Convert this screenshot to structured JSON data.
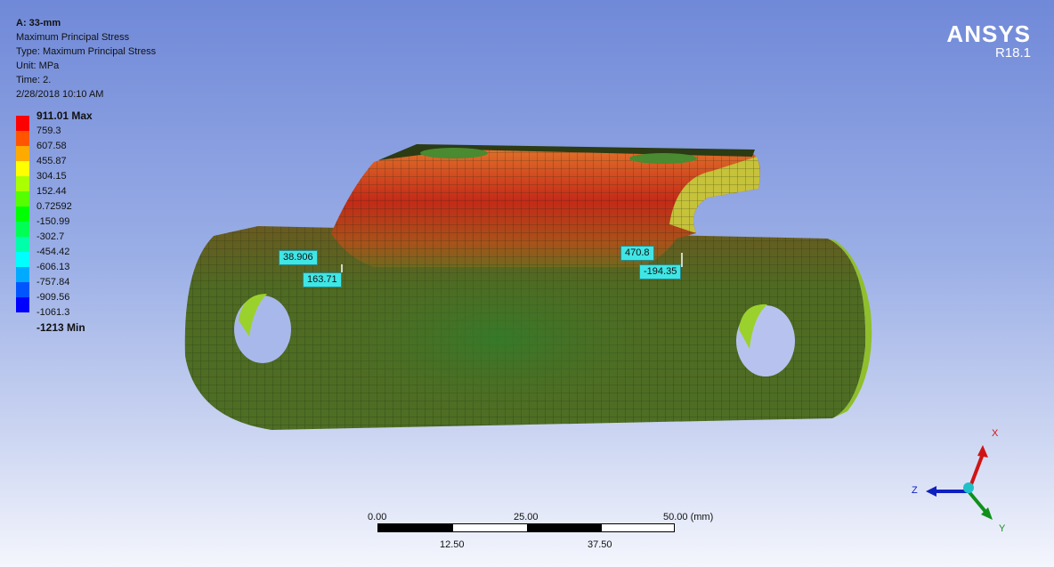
{
  "info": {
    "title": "A: 33-mm",
    "result": "Maximum Principal Stress",
    "type": "Type: Maximum Principal Stress",
    "unit": "Unit: MPa",
    "time": "Time: 2.",
    "datetime": "2/28/2018 10:10 AM"
  },
  "brand": {
    "name": "ANSYS",
    "version": "R18.1"
  },
  "legend": {
    "max_label": "911.01 Max",
    "min_label": "-1213 Min",
    "values": [
      "759.3",
      "607.58",
      "455.87",
      "304.15",
      "152.44",
      "0.72592",
      "-150.99",
      "-302.7",
      "-454.42",
      "-606.13",
      "-757.84",
      "-909.56",
      "-1061.3"
    ],
    "colors": [
      "#ff0000",
      "#ff5500",
      "#ffaa00",
      "#ffff00",
      "#aaff00",
      "#55ff00",
      "#00ff00",
      "#00ff55",
      "#00ffaa",
      "#00ffff",
      "#00aaff",
      "#0055ff",
      "#0000ff"
    ]
  },
  "probes": {
    "p1": "38.906",
    "p2": "163.71",
    "p3": "470.8",
    "p4": "-194.35"
  },
  "scale": {
    "t0": "0.00",
    "t25": "25.00",
    "t50": "50.00 (mm)",
    "t12": "12.50",
    "t37": "37.50"
  },
  "triad": {
    "x": "X",
    "y": "Y",
    "z": "Z"
  }
}
